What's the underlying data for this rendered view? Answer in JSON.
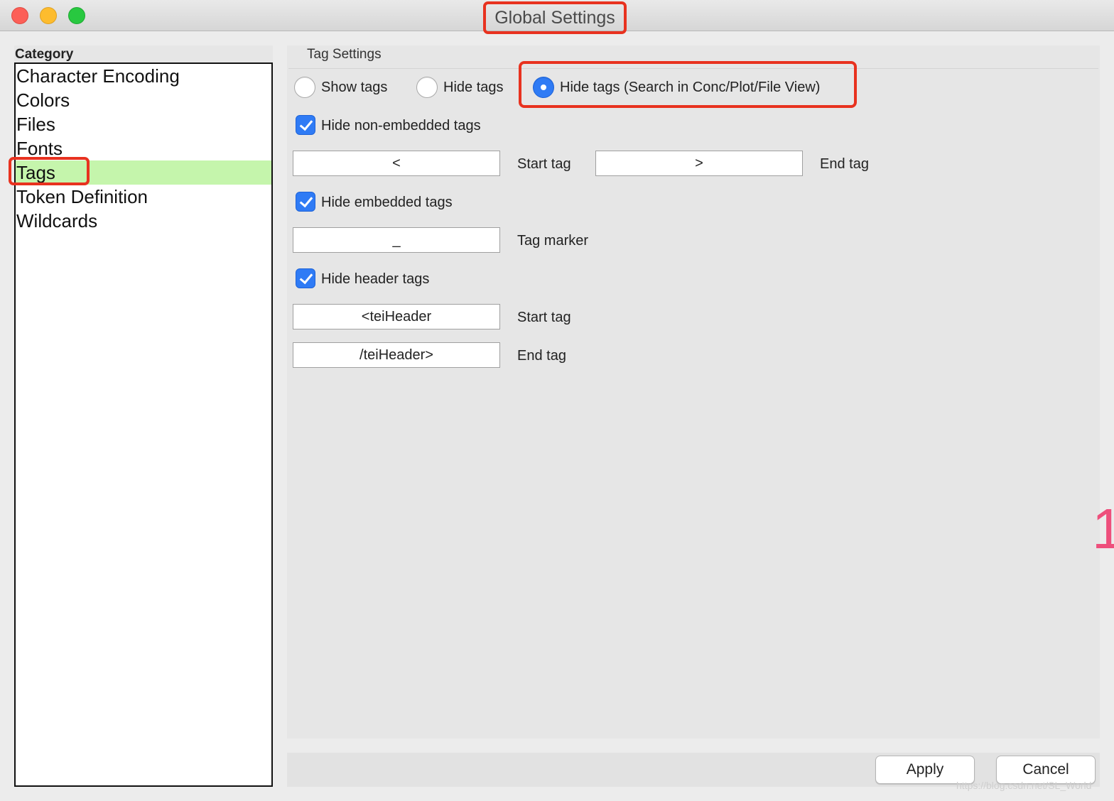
{
  "window": {
    "title": "Global Settings"
  },
  "sidebar": {
    "header": "Category",
    "items": [
      {
        "label": "Character Encoding",
        "selected": false
      },
      {
        "label": "Colors",
        "selected": false
      },
      {
        "label": "Files",
        "selected": false
      },
      {
        "label": "Fonts",
        "selected": false
      },
      {
        "label": "Tags",
        "selected": true
      },
      {
        "label": "Token Definition",
        "selected": false
      },
      {
        "label": "Wildcards",
        "selected": false
      }
    ]
  },
  "tag_settings": {
    "section_title": "Tag Settings",
    "display_mode": {
      "options": [
        "Show tags",
        "Hide tags",
        "Hide tags (Search in Conc/Plot/File View)"
      ],
      "selected": "Hide tags (Search in Conc/Plot/File View)"
    },
    "non_embedded": {
      "checkbox_label": "Hide non-embedded tags",
      "checked": true,
      "start_value": "<",
      "start_label": "Start tag",
      "end_value": ">",
      "end_label": "End tag"
    },
    "embedded": {
      "checkbox_label": "Hide embedded tags",
      "checked": true,
      "marker_value": "_",
      "marker_label": "Tag marker"
    },
    "header": {
      "checkbox_label": "Hide header tags",
      "checked": true,
      "start_value": "<teiHeader",
      "start_label": "Start tag",
      "end_value": "/teiHeader>",
      "end_label": "End tag"
    }
  },
  "buttons": {
    "apply": "Apply",
    "cancel": "Cancel"
  },
  "annotation_mark": "1",
  "watermark": "https://blog.csdn.net/SL_World",
  "colors": {
    "highlight": "#e8321f",
    "selection": "#c5f5ac",
    "accent": "#2f7bf5"
  }
}
